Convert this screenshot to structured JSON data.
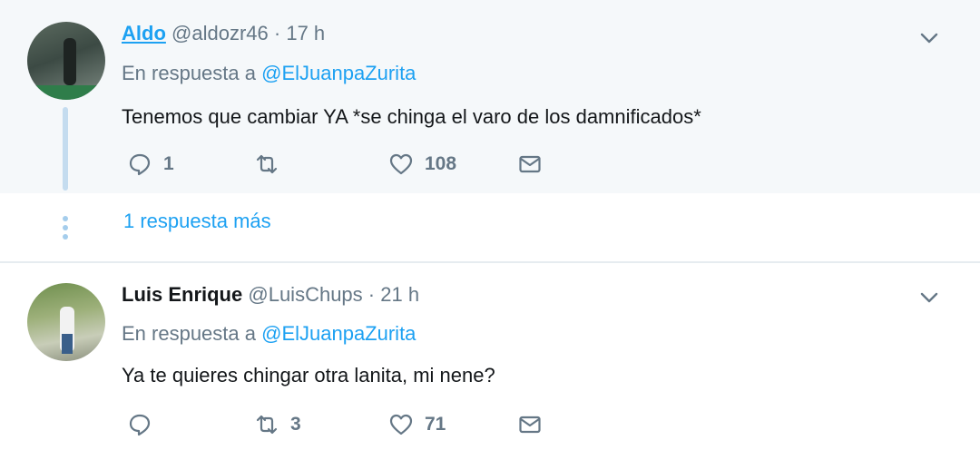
{
  "tweets": [
    {
      "name": "Aldo",
      "handle": "@aldozr46",
      "dot": "·",
      "time": "17 h",
      "replying_prefix": "En respuesta a",
      "replying_to": "@ElJuanpaZurita",
      "text": "Tenemos que cambiar YA *se chinga el varo de los damnificados*",
      "reply_count": "1",
      "retweet_count": "",
      "like_count": "108"
    },
    {
      "name": "Luis Enrique",
      "handle": "@LuisChups",
      "dot": "·",
      "time": "21 h",
      "replying_prefix": "En respuesta a",
      "replying_to": "@ElJuanpaZurita",
      "text": "Ya te quieres chingar otra lanita, mi nene?",
      "reply_count": "",
      "retweet_count": "3",
      "like_count": "71"
    }
  ],
  "thread": {
    "more_replies": "1 respuesta más"
  },
  "colors": {
    "accent": "#1da1f2",
    "muted": "#657786",
    "highlight_bg": "#f5f8fa"
  }
}
